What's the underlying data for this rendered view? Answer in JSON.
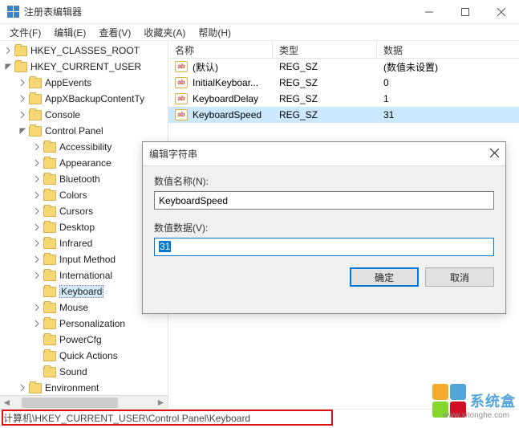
{
  "window": {
    "title": "注册表编辑器"
  },
  "menu": {
    "file": "文件(F)",
    "edit": "编辑(E)",
    "view": "查看(V)",
    "favorites": "收藏夹(A)",
    "help": "帮助(H)"
  },
  "tree": {
    "root1": "HKEY_CLASSES_ROOT",
    "root2": "HKEY_CURRENT_USER",
    "items": [
      "AppEvents",
      "AppXBackupContentTy",
      "Console",
      "Control Panel"
    ],
    "cp_children": [
      "Accessibility",
      "Appearance",
      "Bluetooth",
      "Colors",
      "Cursors",
      "Desktop",
      "Infrared",
      "Input Method",
      "International",
      "Keyboard",
      "Mouse",
      "Personalization",
      "PowerCfg",
      "Quick Actions",
      "Sound",
      "Environment"
    ],
    "selected": "Keyboard"
  },
  "list": {
    "cols": {
      "name": "名称",
      "type": "类型",
      "data": "数据"
    },
    "rows": [
      {
        "name": "(默认)",
        "type": "REG_SZ",
        "data": "(数值未设置)"
      },
      {
        "name": "InitialKeyboar...",
        "type": "REG_SZ",
        "data": "0"
      },
      {
        "name": "KeyboardDelay",
        "type": "REG_SZ",
        "data": "1"
      },
      {
        "name": "KeyboardSpeed",
        "type": "REG_SZ",
        "data": "31"
      }
    ],
    "selected_index": 3
  },
  "dialog": {
    "title": "编辑字符串",
    "name_label": "数值名称(N):",
    "name_value": "KeyboardSpeed",
    "data_label": "数值数据(V):",
    "data_value": "31",
    "ok": "确定",
    "cancel": "取消"
  },
  "statusbar": {
    "path": "计算机\\HKEY_CURRENT_USER\\Control Panel\\Keyboard"
  },
  "watermark": {
    "text": "系统盒",
    "url": "www.xitonghe.com"
  }
}
